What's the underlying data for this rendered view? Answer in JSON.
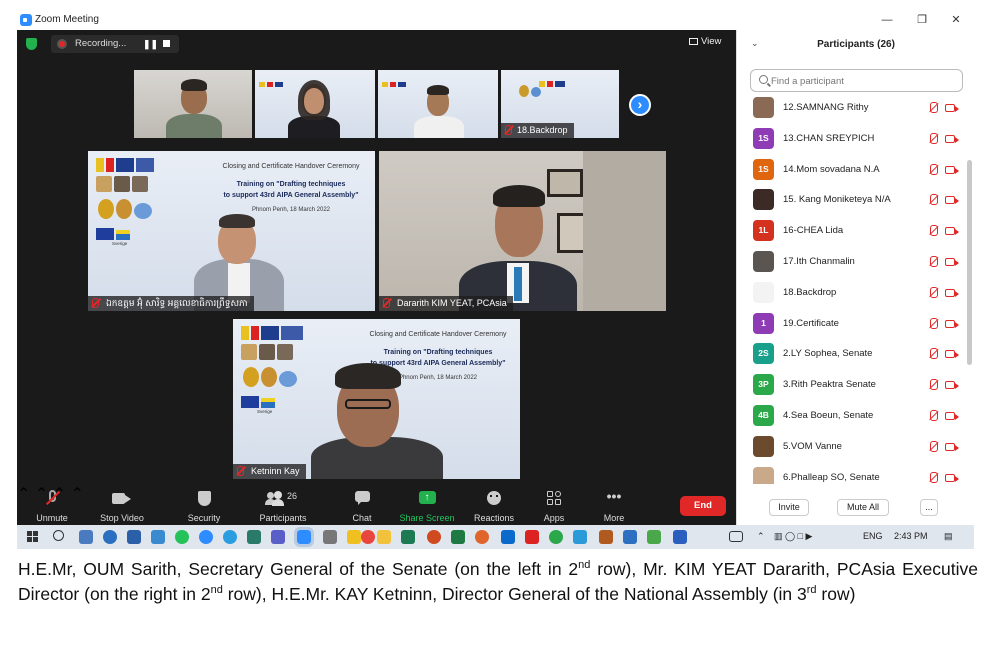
{
  "window": {
    "title": "Zoom Meeting"
  },
  "meeting": {
    "recording_label": "Recording...",
    "view_label": "View"
  },
  "tiles": {
    "top_strip_4_name": "18.Backdrop",
    "gallery_left_name": "ឯកឧត្តម អ៊ុំ សារិទ្ធ អគ្គលេខាធិការព្រឹទ្ធសភា",
    "gallery_right_name": "Dararith KIM YEAT, PCAsia",
    "gallery_bottom_name": "Ketninn Kay"
  },
  "slide": {
    "title": "Closing and Certificate Handover Ceremony",
    "line1": "Training on \"Drafting techniques",
    "line2": "to support 43rd AIPA General Assembly\"",
    "place_date": "Phnom Penh, 18 March 2022",
    "sweden": "Sverige"
  },
  "toolbar": {
    "unmute": "Unmute",
    "stop_video": "Stop Video",
    "security": "Security",
    "participants": "Participants",
    "participants_count": "26",
    "chat": "Chat",
    "share_screen": "Share Screen",
    "reactions": "Reactions",
    "apps": "Apps",
    "more": "More",
    "end": "End"
  },
  "panel": {
    "title": "Participants (26)",
    "search_placeholder": "Find a participant",
    "invite": "Invite",
    "mute_all": "Mute All",
    "more": "...",
    "participants": [
      {
        "avatar": "",
        "name": "12.SAMNANG Rithy",
        "color": "#8a6a55"
      },
      {
        "avatar": "1S",
        "name": "13.CHAN SREYPICH",
        "color": "#8e3bb5"
      },
      {
        "avatar": "1S",
        "name": "14.Mom sovadana N.A",
        "color": "#e0650f"
      },
      {
        "avatar": "",
        "name": "15. Kang Moniketeya N/A",
        "color": "#3b2a26"
      },
      {
        "avatar": "1L",
        "name": "16-CHEA Lida",
        "color": "#d4311f"
      },
      {
        "avatar": "",
        "name": "17.Ith Chanmalin",
        "color": "#5a5550"
      },
      {
        "avatar": "",
        "name": "18.Backdrop",
        "color": "#f3f3f3"
      },
      {
        "avatar": "1",
        "name": "19.Certificate",
        "color": "#8e3bb5"
      },
      {
        "avatar": "2S",
        "name": "2.LY Sophea, Senate",
        "color": "#19a08a"
      },
      {
        "avatar": "3P",
        "name": "3.Rith Peaktra Senate",
        "color": "#2aa84a"
      },
      {
        "avatar": "4B",
        "name": "4.Sea Boeun, Senate",
        "color": "#2aa84a"
      },
      {
        "avatar": "",
        "name": "5.VOM Vanne",
        "color": "#6b4a2e"
      },
      {
        "avatar": "",
        "name": "6.Phalleap SO, Senate",
        "color": "#c9a98a"
      }
    ]
  },
  "taskbar": {
    "lang": "ENG",
    "time": "2:43 PM"
  },
  "caption": {
    "p1": "H.E.Mr, OUM Sarith, Secretary General of the Senate (on the left in 2",
    "sup1": "nd",
    "p2": " row), Mr. KIM YEAT Dararith, PCAsia Executive Director (on the right in 2",
    "sup2": "nd",
    "p3": " row), H.E.Mr. KAY Ketninn, Director General of the National Assembly (in 3",
    "sup3": "rd",
    "p4": " row)"
  }
}
